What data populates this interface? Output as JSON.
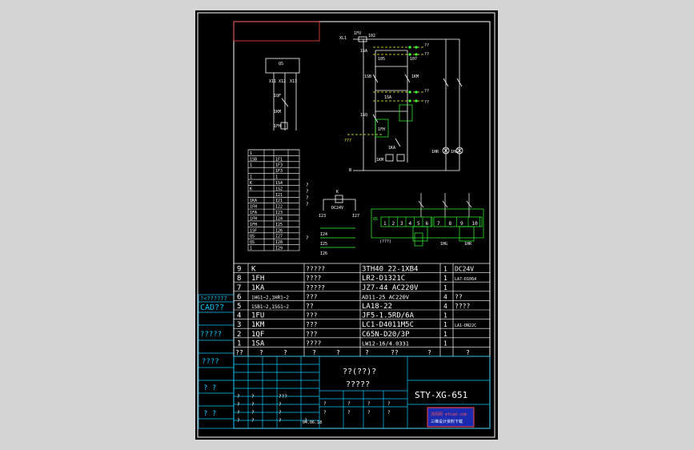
{
  "colors": {
    "background": "#d4d4d4",
    "sheet": "#000000",
    "frame": "#ffffff",
    "table_lines": "#00c8ff",
    "circuit": "#ffffff",
    "terminals": "#33ff33",
    "dashed": "#ffff33",
    "red_border": "#ff4444",
    "logo_bg": "#1a2bb0"
  },
  "left_labels": [
    "?<??????",
    "CAD??",
    "?????",
    "????",
    "? ?",
    "? ?"
  ],
  "circuit": {
    "labels": [
      "XL1",
      "1FU",
      "102",
      "103",
      "1SA",
      "??",
      "??",
      "104",
      "105",
      "106",
      "107",
      "1SB",
      "1KM",
      "108",
      "109",
      "1SA",
      "??",
      "??",
      "110",
      "111",
      "112",
      "113",
      "1SQ",
      "1FH",
      "114",
      "115",
      "???",
      "1KA",
      "1KM",
      "1KM",
      "1HR",
      "1HG",
      "??",
      "N",
      "QS",
      "K",
      "X11",
      "X12",
      "X13",
      "1QF",
      "1KM",
      "1FH",
      "DC24V",
      "I23",
      "I27",
      "I24",
      "I25",
      "I26",
      "2",
      "3",
      "4",
      "5",
      "6",
      "7",
      "8",
      "9",
      "10",
      "1HG",
      "1HR",
      "(???)"
    ]
  },
  "terminal_table": {
    "rows": [
      [
        "1",
        ""
      ],
      [
        "1SB",
        "1F1"
      ],
      [
        "1",
        "1F3"
      ],
      [
        "",
        "1F3"
      ],
      [
        "1",
        "1"
      ],
      [
        "K",
        "1S4"
      ],
      [
        "K",
        "1S2"
      ],
      [
        "",
        "I21"
      ],
      [
        "1KA",
        "I21"
      ],
      [
        "1FH",
        "I22"
      ],
      [
        "1FA",
        "I23"
      ],
      [
        "1FH",
        "I24"
      ],
      [
        "1FH",
        "I25"
      ],
      [
        "1SF",
        "I26"
      ],
      [
        "QS",
        "I27"
      ],
      [
        "QS",
        "I28"
      ],
      [
        "1",
        "I29"
      ]
    ],
    "side": [
      "?",
      "?",
      "?",
      "?",
      "?"
    ]
  },
  "bom": {
    "rows": [
      {
        "no": "9",
        "code": "K",
        "name": "?????",
        "model": "3TH40 22-1XB4",
        "qty": "1",
        "note": "DC24V"
      },
      {
        "no": "8",
        "code": "1FH",
        "name": "????",
        "model": "LR2-D1321C",
        "qty": "1",
        "note": "LA7-D1064"
      },
      {
        "no": "7",
        "code": "1KA",
        "name": "?????",
        "model": "JZ7-44 AC220V",
        "qty": "1",
        "note": ""
      },
      {
        "no": "6",
        "code": "1HG1~2,1HR1~2",
        "name": "???",
        "model": "AD11-25 AC220V",
        "qty": "4",
        "note": "??"
      },
      {
        "no": "5",
        "code": "1SB1~2,1SG1~2",
        "name": "??",
        "model": "LA18-22",
        "qty": "4",
        "note": "????"
      },
      {
        "no": "4",
        "code": "1FU",
        "name": "???",
        "model": "JF5-1.5RD/6A",
        "qty": "1",
        "note": ""
      },
      {
        "no": "3",
        "code": "1KM",
        "name": "???",
        "model": "LC1-D4011M5C",
        "qty": "1",
        "note": "LA1-DN22C"
      },
      {
        "no": "2",
        "code": "1QF",
        "name": "???",
        "model": "C65N-D20/3P",
        "qty": "1",
        "note": ""
      },
      {
        "no": "1",
        "code": "1SA",
        "name": "????",
        "model": "LW12-16/4.0331",
        "qty": "1",
        "note": ""
      }
    ],
    "header": [
      "??",
      "?",
      "?",
      "?",
      "?",
      "?",
      "??",
      "?",
      "?"
    ]
  },
  "title_block": {
    "title_line1": "??(??)?",
    "title_line2": "?????",
    "drawing_no": "STY-XG-651",
    "date": "04.06.18",
    "logo_line1": "沐风网 mfcad.com",
    "logo_line2": "三维设计资料下载"
  }
}
